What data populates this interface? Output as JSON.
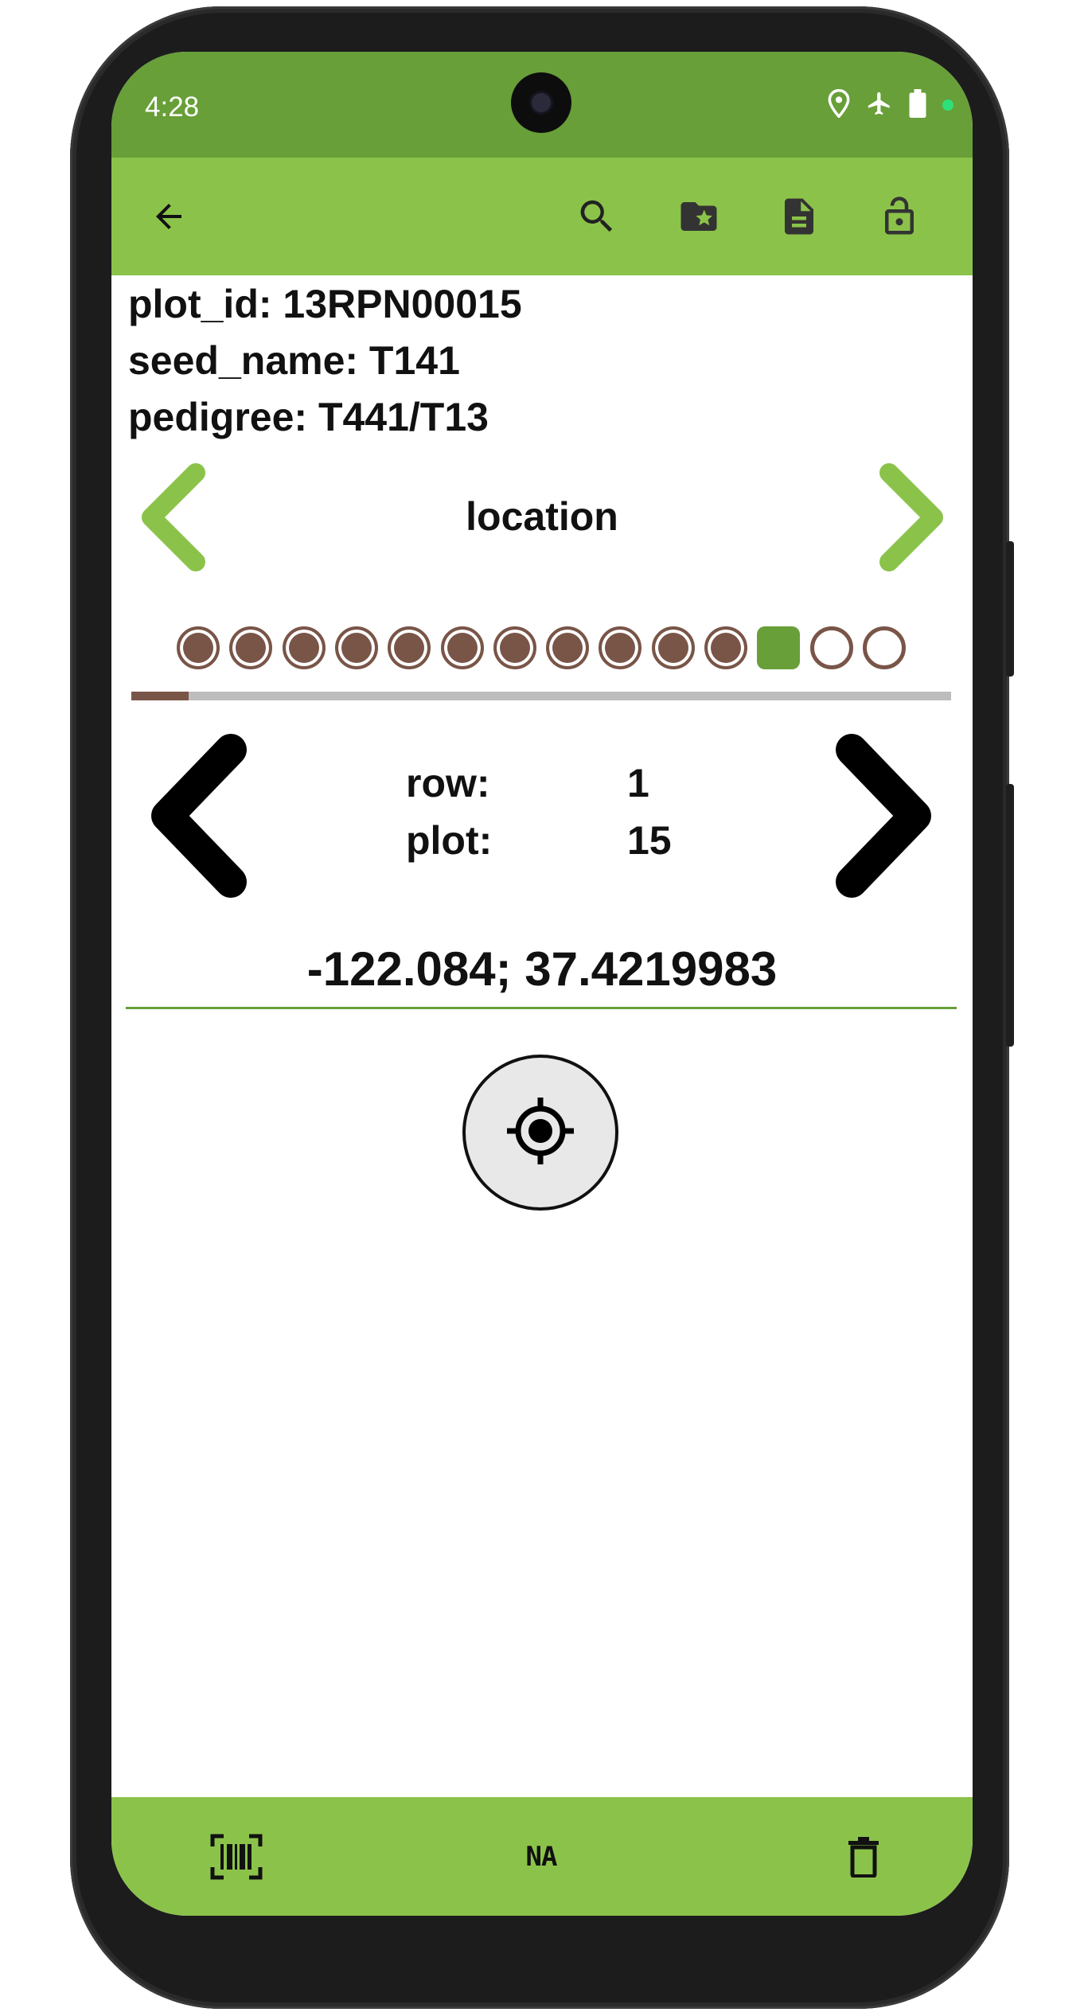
{
  "status_bar": {
    "time": "4:28",
    "icons": [
      "location-pin-icon",
      "airplane-mode-icon",
      "battery-icon",
      "privacy-indicator-dot"
    ],
    "bg_color": "#689f38"
  },
  "toolbar": {
    "bg_color": "#8bc34a",
    "icons": [
      "back-arrow-icon",
      "search-icon",
      "folder-star-icon",
      "document-icon",
      "unlock-icon"
    ]
  },
  "plot_info": {
    "plot_id": "plot_id: 13RPN00015",
    "seed_name": "seed_name: T141",
    "pedigree": "pedigree: T441/T13"
  },
  "trait": {
    "name": "location",
    "accent_color": "#8bc34a"
  },
  "trait_progress": {
    "states": [
      "done",
      "done",
      "done",
      "done",
      "done",
      "done",
      "done",
      "done",
      "done",
      "done",
      "done",
      "current",
      "empty",
      "empty"
    ],
    "completed_color": "#795548",
    "current_color": "#689f38",
    "bar_fill_fraction": 0.07
  },
  "range_plot": {
    "row_label": "row:",
    "row_value": "1",
    "plot_label": "plot:",
    "plot_value": "15"
  },
  "location": {
    "value": "-122.084; 37.4219983"
  },
  "bottom_bar": {
    "bg_color": "#8bc34a",
    "icons": [
      "barcode-scan-icon",
      "na-icon",
      "delete-icon"
    ],
    "na_label": "NA"
  }
}
